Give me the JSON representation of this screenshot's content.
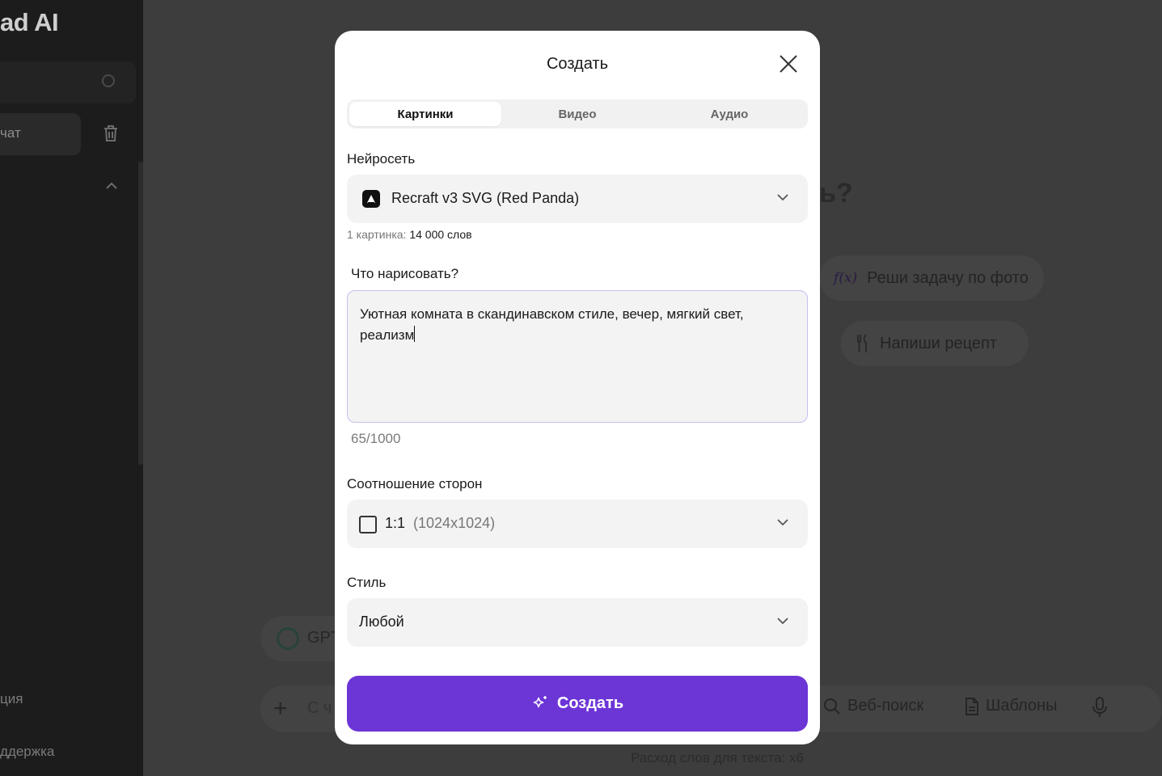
{
  "background": {
    "sidebar": {
      "logo": "ad AI",
      "chat_item": "чат",
      "bottom_items": [
        "ция",
        "ддержка"
      ]
    },
    "heading_fragment": "ь?",
    "suggestions": [
      {
        "icon": "function-icon",
        "label": "Реши задачу по фото",
        "icon_text": "f(x)"
      },
      {
        "icon": "fork-knife-icon",
        "label": "Напиши рецепт"
      }
    ],
    "model_pill": "GPT",
    "input_placeholder": "С ч",
    "tools": {
      "web_search": "Веб-поиск",
      "templates": "Шаблоны"
    },
    "usage_note": "Расход слов для текста: х6"
  },
  "modal": {
    "title": "Создать",
    "tabs": [
      {
        "label": "Картинки",
        "active": true
      },
      {
        "label": "Видео",
        "active": false
      },
      {
        "label": "Аудио",
        "active": false
      }
    ],
    "neural_net": {
      "label": "Нейросеть",
      "value": "Recraft v3 SVG (Red Panda)",
      "cost_prefix": "1 картинка:",
      "cost_value": "14 000 слов"
    },
    "prompt": {
      "label": "Что нарисовать?",
      "value": "Уютная комната в скандинавском стиле, вечер, мягкий свет, реализм",
      "counter": "65/1000"
    },
    "aspect_ratio": {
      "label": "Соотношение сторон",
      "value": "1:1",
      "detail": "(1024x1024)"
    },
    "style": {
      "label": "Стиль",
      "value": "Любой"
    },
    "submit_label": "Создать"
  },
  "colors": {
    "accent": "#6c35d6",
    "overlay": "#3d3d3d"
  }
}
